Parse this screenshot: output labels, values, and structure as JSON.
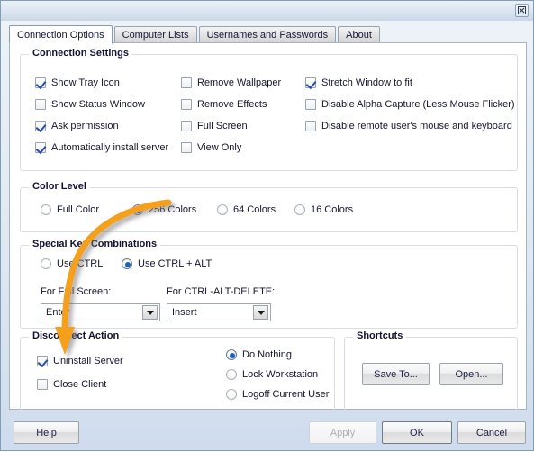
{
  "window": {
    "close_icon": "close-icon"
  },
  "tabs": [
    {
      "label": "Connection Options",
      "active": true
    },
    {
      "label": "Computer Lists",
      "active": false
    },
    {
      "label": "Usernames and Passwords",
      "active": false
    },
    {
      "label": "About",
      "active": false
    }
  ],
  "connection_settings": {
    "legend": "Connection Settings",
    "column1": [
      {
        "label": "Show Tray Icon",
        "checked": true
      },
      {
        "label": "Show Status Window",
        "checked": false
      },
      {
        "label": "Ask permission",
        "checked": true
      },
      {
        "label": "Automatically install server",
        "checked": true
      }
    ],
    "column2": [
      {
        "label": "Remove Wallpaper",
        "checked": false
      },
      {
        "label": "Remove Effects",
        "checked": false
      },
      {
        "label": "Full Screen",
        "checked": false
      },
      {
        "label": "View Only",
        "checked": false
      }
    ],
    "column3": [
      {
        "label": "Stretch Window to fit",
        "checked": true
      },
      {
        "label": "Disable Alpha Capture (Less Mouse Flicker)",
        "checked": false
      },
      {
        "label": "Disable remote user's mouse and keyboard",
        "checked": false
      }
    ]
  },
  "color_level": {
    "legend": "Color Level",
    "options": [
      {
        "label": "Full Color",
        "selected": false
      },
      {
        "label": "256 Colors",
        "selected": true
      },
      {
        "label": "64 Colors",
        "selected": false
      },
      {
        "label": "16 Colors",
        "selected": false
      }
    ]
  },
  "special_keys": {
    "legend": "Special Key Combinations",
    "options": [
      {
        "label": "Use CTRL",
        "selected": false
      },
      {
        "label": "Use CTRL + ALT",
        "selected": true
      }
    ],
    "full_screen_label": "For Full Screen:",
    "full_screen_value": "Enter",
    "ctrl_alt_del_label": "For CTRL-ALT-DELETE:",
    "ctrl_alt_del_value": "Insert"
  },
  "disconnect_action": {
    "legend": "Disconnect Action",
    "checkboxes": [
      {
        "label": "Uninstall Server",
        "checked": true
      },
      {
        "label": "Close Client",
        "checked": false
      }
    ],
    "radios": [
      {
        "label": "Do Nothing",
        "selected": true
      },
      {
        "label": "Lock Workstation",
        "selected": false
      },
      {
        "label": "Logoff Current User",
        "selected": false
      }
    ]
  },
  "shortcuts": {
    "legend": "Shortcuts",
    "save_to_label": "Save To...",
    "open_label": "Open..."
  },
  "footer": {
    "help_label": "Help",
    "apply_label": "Apply",
    "ok_label": "OK",
    "cancel_label": "Cancel"
  },
  "annotation": {
    "color": "#F5A01E",
    "description": "curved arrow pointing to Uninstall Server"
  }
}
